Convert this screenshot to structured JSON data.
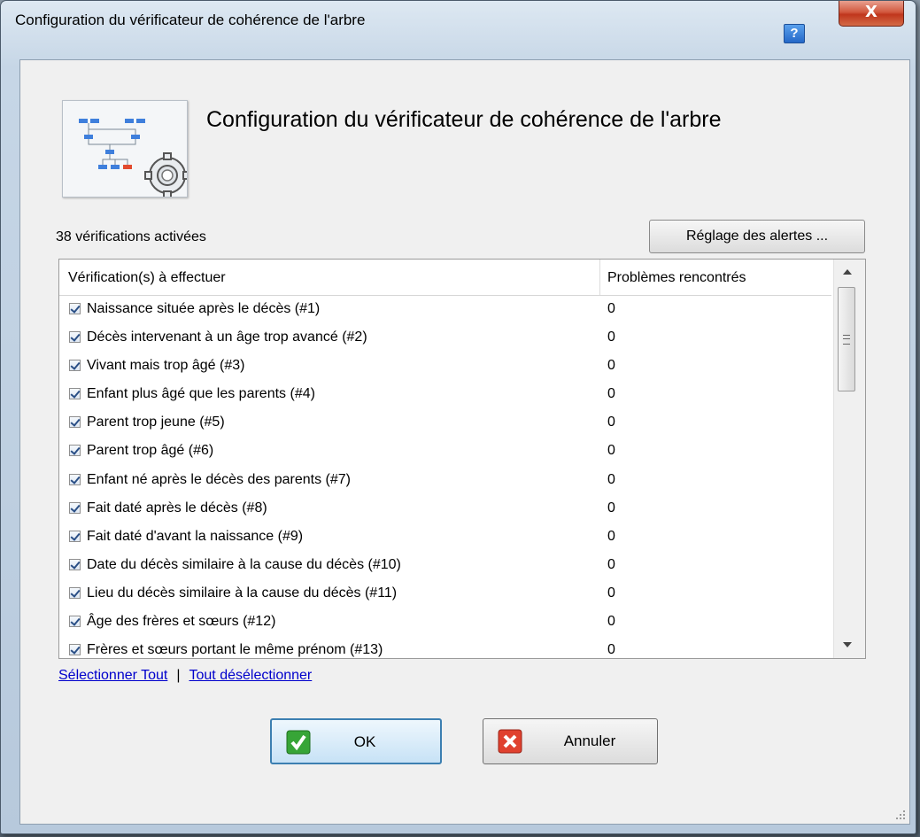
{
  "window": {
    "title": "Configuration du vérificateur de cohérence de l'arbre"
  },
  "titlebar": {
    "help_label": "?",
    "close_label": "X"
  },
  "header": {
    "title": "Configuration du vérificateur de cohérence de l'arbre"
  },
  "summary": {
    "count_text": "38 vérifications activées"
  },
  "toolbar": {
    "alerts_button_label": "Réglage des alertes ..."
  },
  "grid": {
    "columns": [
      "Vérification(s) à effectuer",
      "Problèmes rencontrés"
    ],
    "rows": [
      {
        "label": "Naissance située après le décès (#1)",
        "value": "0",
        "checked": true
      },
      {
        "label": "Décès intervenant à un âge trop avancé (#2)",
        "value": "0",
        "checked": true
      },
      {
        "label": "Vivant mais trop âgé (#3)",
        "value": "0",
        "checked": true
      },
      {
        "label": "Enfant plus âgé que les parents (#4)",
        "value": "0",
        "checked": true
      },
      {
        "label": "Parent trop jeune (#5)",
        "value": "0",
        "checked": true
      },
      {
        "label": "Parent trop âgé (#6)",
        "value": "0",
        "checked": true
      },
      {
        "label": "Enfant né après le décès des parents (#7)",
        "value": "0",
        "checked": true
      },
      {
        "label": "Fait daté après le décès (#8)",
        "value": "0",
        "checked": true
      },
      {
        "label": "Fait daté d'avant la naissance (#9)",
        "value": "0",
        "checked": true
      },
      {
        "label": "Date du décès similaire à la cause du décès (#10)",
        "value": "0",
        "checked": true
      },
      {
        "label": "Lieu du décès similaire à la cause du décès (#11)",
        "value": "0",
        "checked": true
      },
      {
        "label": "Âge des frères et sœurs (#12)",
        "value": "0",
        "checked": true
      },
      {
        "label": "Frères et sœurs portant le même prénom (#13)",
        "value": "0",
        "checked": true
      }
    ]
  },
  "links": {
    "select_all": "Sélectionner Tout",
    "separator": "|",
    "deselect_all": "Tout désélectionner"
  },
  "buttons": {
    "ok": "OK",
    "cancel": "Annuler"
  },
  "colors": {
    "link": "#0000cc",
    "ok_check": "#2f9a2f",
    "cancel_x": "#d83a2a"
  }
}
